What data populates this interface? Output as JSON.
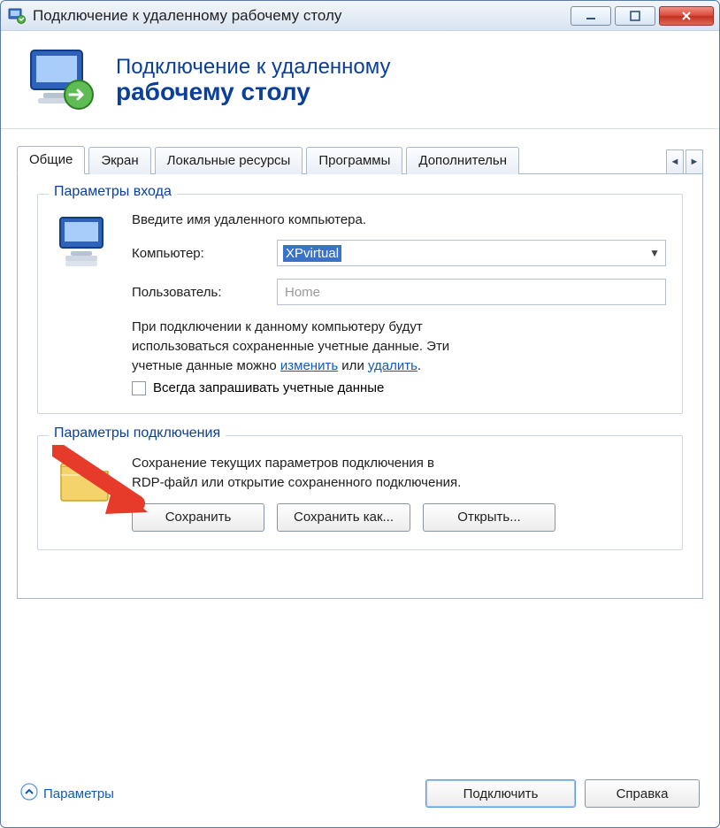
{
  "window": {
    "title": "Подключение к удаленному рабочему столу"
  },
  "banner": {
    "line1": "Подключение к удаленному",
    "line2": "рабочему столу"
  },
  "tabs": [
    "Общие",
    "Экран",
    "Локальные ресурсы",
    "Программы",
    "Дополнительн"
  ],
  "login_group": {
    "legend": "Параметры входа",
    "intro": "Введите имя удаленного компьютера.",
    "computer_label": "Компьютер:",
    "computer_value": "XPvirtual",
    "user_label": "Пользователь:",
    "user_value": "Home",
    "cred_line1": "При подключении к данному компьютеру будут",
    "cred_line2": "использоваться сохраненные учетные данные. Эти",
    "cred_line3a": "учетные данные можно ",
    "cred_link_edit": "изменить",
    "cred_line3b": " или ",
    "cred_link_delete": "удалить",
    "cred_line3c": ".",
    "checkbox_label": "Всегда запрашивать учетные данные"
  },
  "conn_group": {
    "legend": "Параметры подключения",
    "text_line1": "Сохранение текущих параметров подключения в",
    "text_line2": "RDP-файл или открытие сохраненного подключения.",
    "save_btn": "Сохранить",
    "save_as_btn": "Сохранить как...",
    "open_btn": "Открыть..."
  },
  "footer": {
    "options_label": "Параметры",
    "connect_btn": "Подключить",
    "help_btn": "Справка"
  },
  "colors": {
    "accent": "#0a3f9b",
    "link": "#0b5cc1",
    "annotation": "#e63a2a"
  }
}
